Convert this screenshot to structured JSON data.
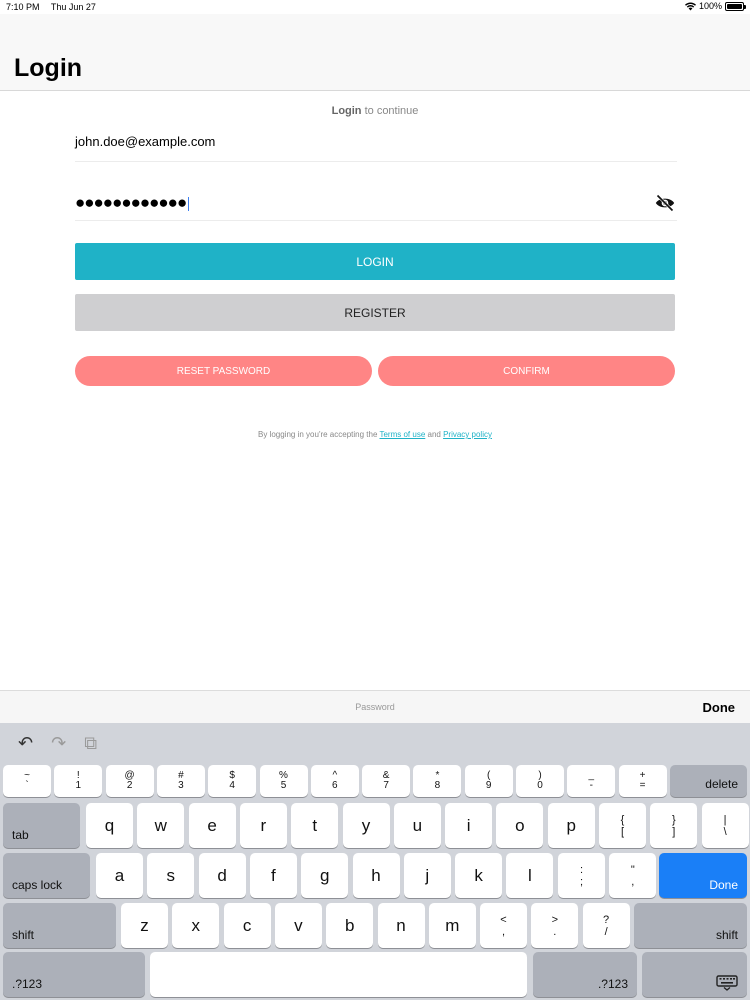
{
  "status": {
    "time": "7:10 PM",
    "date": "Thu Jun 27",
    "battery": "100%",
    "wifi_icon": "wifi-icon",
    "battery_level": 1.0
  },
  "nav": {
    "title": "Login"
  },
  "form": {
    "subtitle_bold": "Login",
    "subtitle_rest": " to continue",
    "email_value": "john.doe@example.com",
    "password_value": "●●●●●●●●●●●●",
    "toggle_icon": "eye-slash-icon"
  },
  "buttons": {
    "login": "LOGIN",
    "register": "REGISTER",
    "reset": "RESET PASSWORD",
    "confirm": "CONFIRM"
  },
  "terms": {
    "prefix": "By logging in you're accepting the ",
    "terms_link": "Terms of use",
    "middle": " and ",
    "privacy_link": "Privacy policy"
  },
  "accessory": {
    "hint": "Password",
    "done": "Done"
  },
  "keyboard": {
    "tools": {
      "undo": "↶",
      "redo": "↷",
      "paste": "⧉"
    },
    "row1": [
      {
        "t": "~",
        "b": "`"
      },
      {
        "t": "!",
        "b": "1"
      },
      {
        "t": "@",
        "b": "2"
      },
      {
        "t": "#",
        "b": "3"
      },
      {
        "t": "$",
        "b": "4"
      },
      {
        "t": "%",
        "b": "5"
      },
      {
        "t": "^",
        "b": "6"
      },
      {
        "t": "&",
        "b": "7"
      },
      {
        "t": "*",
        "b": "8"
      },
      {
        "t": "(",
        "b": "9"
      },
      {
        "t": ")",
        "b": "0"
      },
      {
        "t": "_",
        "b": "-"
      },
      {
        "t": "+",
        "b": "="
      }
    ],
    "delete": "delete",
    "tab": "tab",
    "row2": [
      "q",
      "w",
      "e",
      "r",
      "t",
      "y",
      "u",
      "i",
      "o",
      "p"
    ],
    "row2_extra": [
      {
        "t": "{",
        "b": "["
      },
      {
        "t": "}",
        "b": "]"
      },
      {
        "t": "|",
        "b": "\\"
      }
    ],
    "caps": "caps lock",
    "row3": [
      "a",
      "s",
      "d",
      "f",
      "g",
      "h",
      "j",
      "k",
      "l"
    ],
    "row3_extra": [
      {
        "t": ":",
        "b": ";"
      },
      {
        "t": "\"",
        "b": ","
      }
    ],
    "done": "Done",
    "shift": "shift",
    "row4": [
      "z",
      "x",
      "c",
      "v",
      "b",
      "n",
      "m"
    ],
    "row4_extra": [
      {
        "t": "<",
        "b": ","
      },
      {
        "t": ">",
        "b": "."
      },
      {
        "t": "?",
        "b": "/"
      }
    ],
    "num": ".?123",
    "dismiss_icon": "keyboard-dismiss-icon"
  }
}
